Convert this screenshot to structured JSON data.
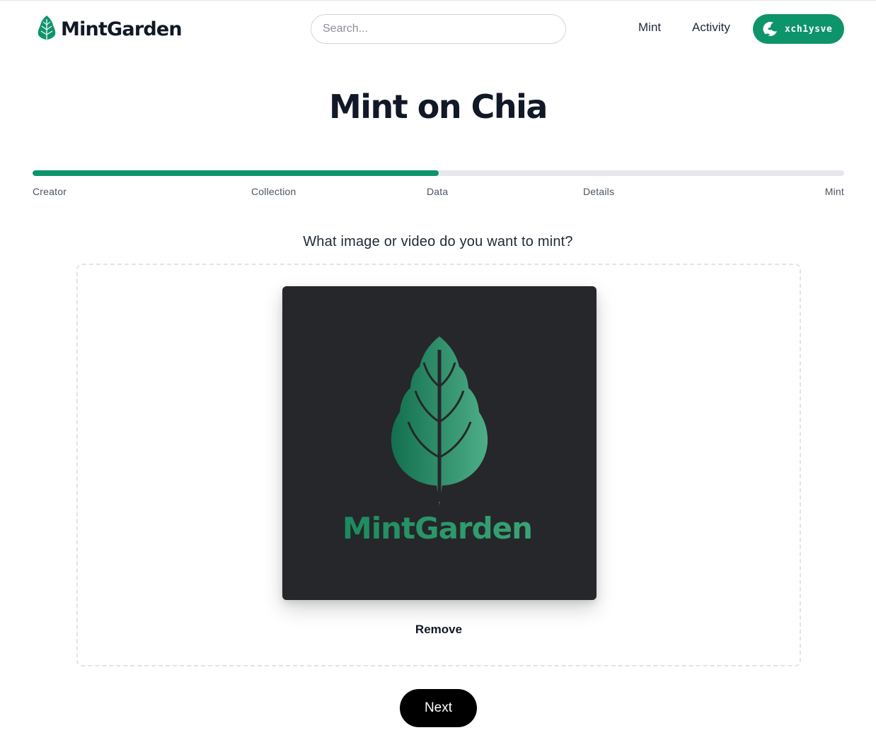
{
  "app": {
    "name": "MintGarden"
  },
  "header": {
    "logo_text": "MintGarden",
    "search": {
      "placeholder": "Search...",
      "value": ""
    },
    "nav": [
      {
        "label": "Mint"
      },
      {
        "label": "Activity"
      }
    ],
    "wallet_label": "xch1ysve"
  },
  "page": {
    "title": "Mint on Chia",
    "progress": {
      "fraction": 0.5,
      "steps": [
        "Creator",
        "Collection",
        "Data",
        "Details",
        "Mint"
      ],
      "current_step": "Data"
    },
    "question": "What image or video do you want to mint?",
    "preview": {
      "image_text": "MintGarden"
    },
    "remove_label": "Remove",
    "next_label": "Next"
  },
  "colors": {
    "accent": "#0e946a",
    "preview_bg": "#26272a",
    "leaf_dark": "#136f4f",
    "leaf_light": "#4eae88"
  },
  "icons": {
    "logo": "leaf-icon",
    "wallet": "wallet-avatar-icon"
  }
}
